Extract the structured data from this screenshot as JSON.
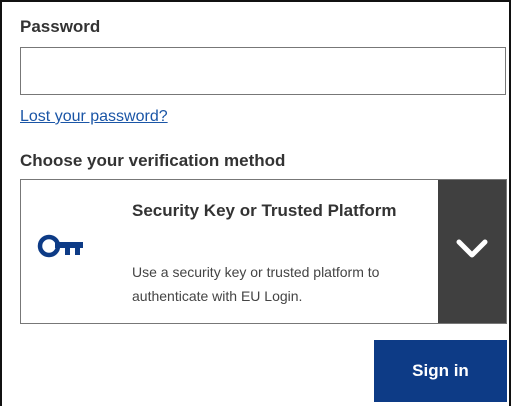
{
  "password": {
    "label": "Password",
    "value": "",
    "placeholder": ""
  },
  "lost_password": {
    "label": "Lost your password?"
  },
  "verification": {
    "label": "Choose your verification method",
    "selected": {
      "title": "Security Key or Trusted Platform",
      "description": "Use a security key or trusted platform to authenticate with EU Login.",
      "icon": "key-icon"
    },
    "toggle_icon": "chevron-down-icon"
  },
  "signin": {
    "label": "Sign in"
  },
  "colors": {
    "link": "#1a55a6",
    "primary_button": "#0d3b86",
    "dropdown_toggle": "#404040",
    "key_icon": "#0d3b86"
  }
}
